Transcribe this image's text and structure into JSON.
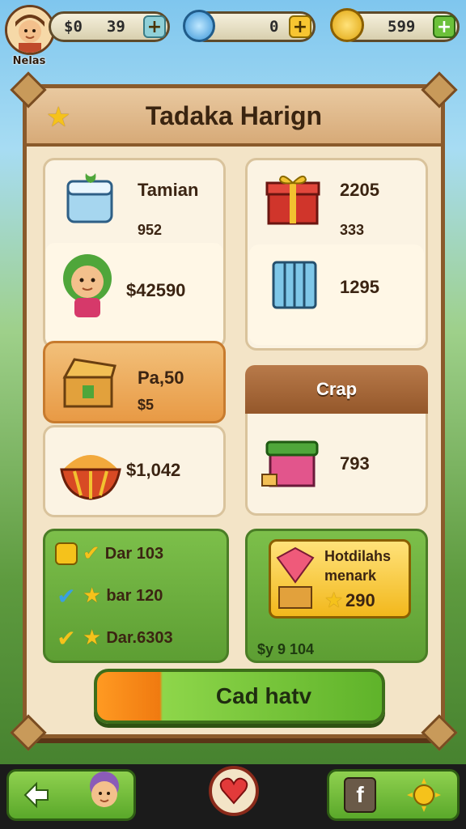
{
  "player": {
    "name": "Nelas"
  },
  "currencies": {
    "first": {
      "label": "$0",
      "value": "39"
    },
    "energy": {
      "value": "0"
    },
    "coins": {
      "value": "599"
    }
  },
  "panel": {
    "title": "Tadaka Harign",
    "cards": {
      "tamian": {
        "title": "Tamian",
        "value": "952"
      },
      "gift": {
        "value1": "2205",
        "value2": "333"
      },
      "character": {
        "price": "$42590"
      },
      "radiator": {
        "value": "1295"
      },
      "chest": {
        "value1": "Pa,50",
        "value2": "$5"
      },
      "crap": {
        "title": "Crap",
        "value": "793"
      },
      "bowl": {
        "price": "$1,042"
      }
    },
    "dar_list": [
      {
        "label": "Dar 103"
      },
      {
        "label": "bar 120"
      },
      {
        "label": "Dar.6303"
      }
    ],
    "highlight": {
      "title_line1": "Hotdilahs",
      "title_line2": "menark",
      "stars": "290",
      "footer": "$y 9 104"
    },
    "cta_label": "Cad hatv"
  },
  "colors": {
    "accent_green": "#5fb32a",
    "accent_orange": "#f07a10",
    "frame_brown": "#8a5a2b"
  },
  "icons": [
    "plus-icon",
    "back-arrow-icon",
    "heart-icon",
    "facebook-icon",
    "sun-icon",
    "star-icon",
    "check-icon"
  ]
}
